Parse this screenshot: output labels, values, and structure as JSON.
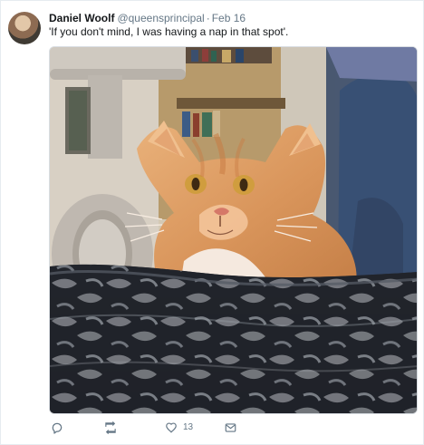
{
  "tweet": {
    "display_name": "Daniel Woolf",
    "handle": "@queensprincipal",
    "separator": "·",
    "timestamp": "Feb 16",
    "text": "'If you don't mind, I was having a nap in that spot'.",
    "actions": {
      "like_count": "13"
    },
    "icons": {
      "reply": "reply-icon",
      "retweet": "retweet-icon",
      "like": "heart-icon",
      "direct_message": "envelope-icon"
    }
  },
  "colors": {
    "text_primary": "#14171a",
    "text_secondary": "#657786",
    "border": "#e6ecf0"
  }
}
